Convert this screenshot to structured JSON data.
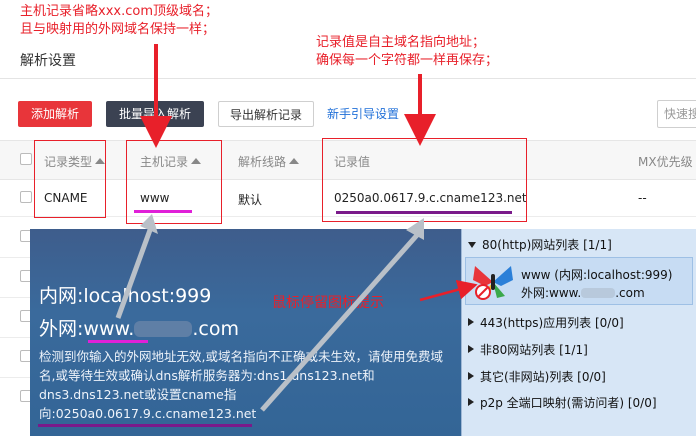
{
  "annotations": {
    "host_note_1": "主机记录省略xxx.com顶级域名；",
    "host_note_2": "且与映射用的外网域名保持一样；",
    "value_note_1": "记录值是自主域名指向地址；",
    "value_note_2": "确保每一个字符都一样再保存；",
    "hover_note": "鼠标停留图标提示"
  },
  "page": {
    "title": "解析设置"
  },
  "toolbar": {
    "add_label": "添加解析",
    "import_label": "批量导入解析",
    "export_label": "导出解析记录",
    "guide_label": "新手引导设置",
    "search_placeholder": "快速搜"
  },
  "table": {
    "headers": [
      "记录类型",
      "主机记录",
      "解析线路",
      "记录值",
      "MX优先级"
    ],
    "rows": [
      {
        "type": "CNAME",
        "host": "www",
        "line": "默认",
        "value": "0250a0.0617.9.c.cname123.net",
        "mx": "--"
      }
    ]
  },
  "tooltip": {
    "lan": "内网:localhost:999",
    "wan": "外网:www.",
    "wan_suffix": ".com",
    "message": "检测到你输入的外网地址无效,或域名指向不正确或未生效，请使用免费域名,或等待生效或确认dns解析服务器为:dns1.dns123.net和dns3.dns123.net或设置cname指向:0250a0.0617.9.c.cname123.net"
  },
  "side_panel": {
    "items": [
      {
        "label": "80(http)网站列表   [1/1]",
        "expanded": true
      },
      {
        "label": "443(https)应用列表   [0/0]",
        "expanded": false
      },
      {
        "label": "非80网站列表   [1/1]",
        "expanded": false
      },
      {
        "label": "其它(非网站)列表   [0/0]",
        "expanded": false
      },
      {
        "label": "p2p 全端口映射(需访问者)   [0/0]",
        "expanded": false
      }
    ],
    "selected_line1": "www  (内网:localhost:999)",
    "selected_line2": "外网:www.",
    "selected_line2_suffix": ".com"
  },
  "colors": {
    "annotation_red": "#e8202a",
    "add_button": "#e8353a",
    "import_button": "#3b4252",
    "link_blue": "#1f6fd8",
    "host_underline": "#e020d8",
    "value_underline": "#7a1a8a",
    "tooltip_bg": "#3a6a9c",
    "panel_bg": "#d7e6f6"
  }
}
